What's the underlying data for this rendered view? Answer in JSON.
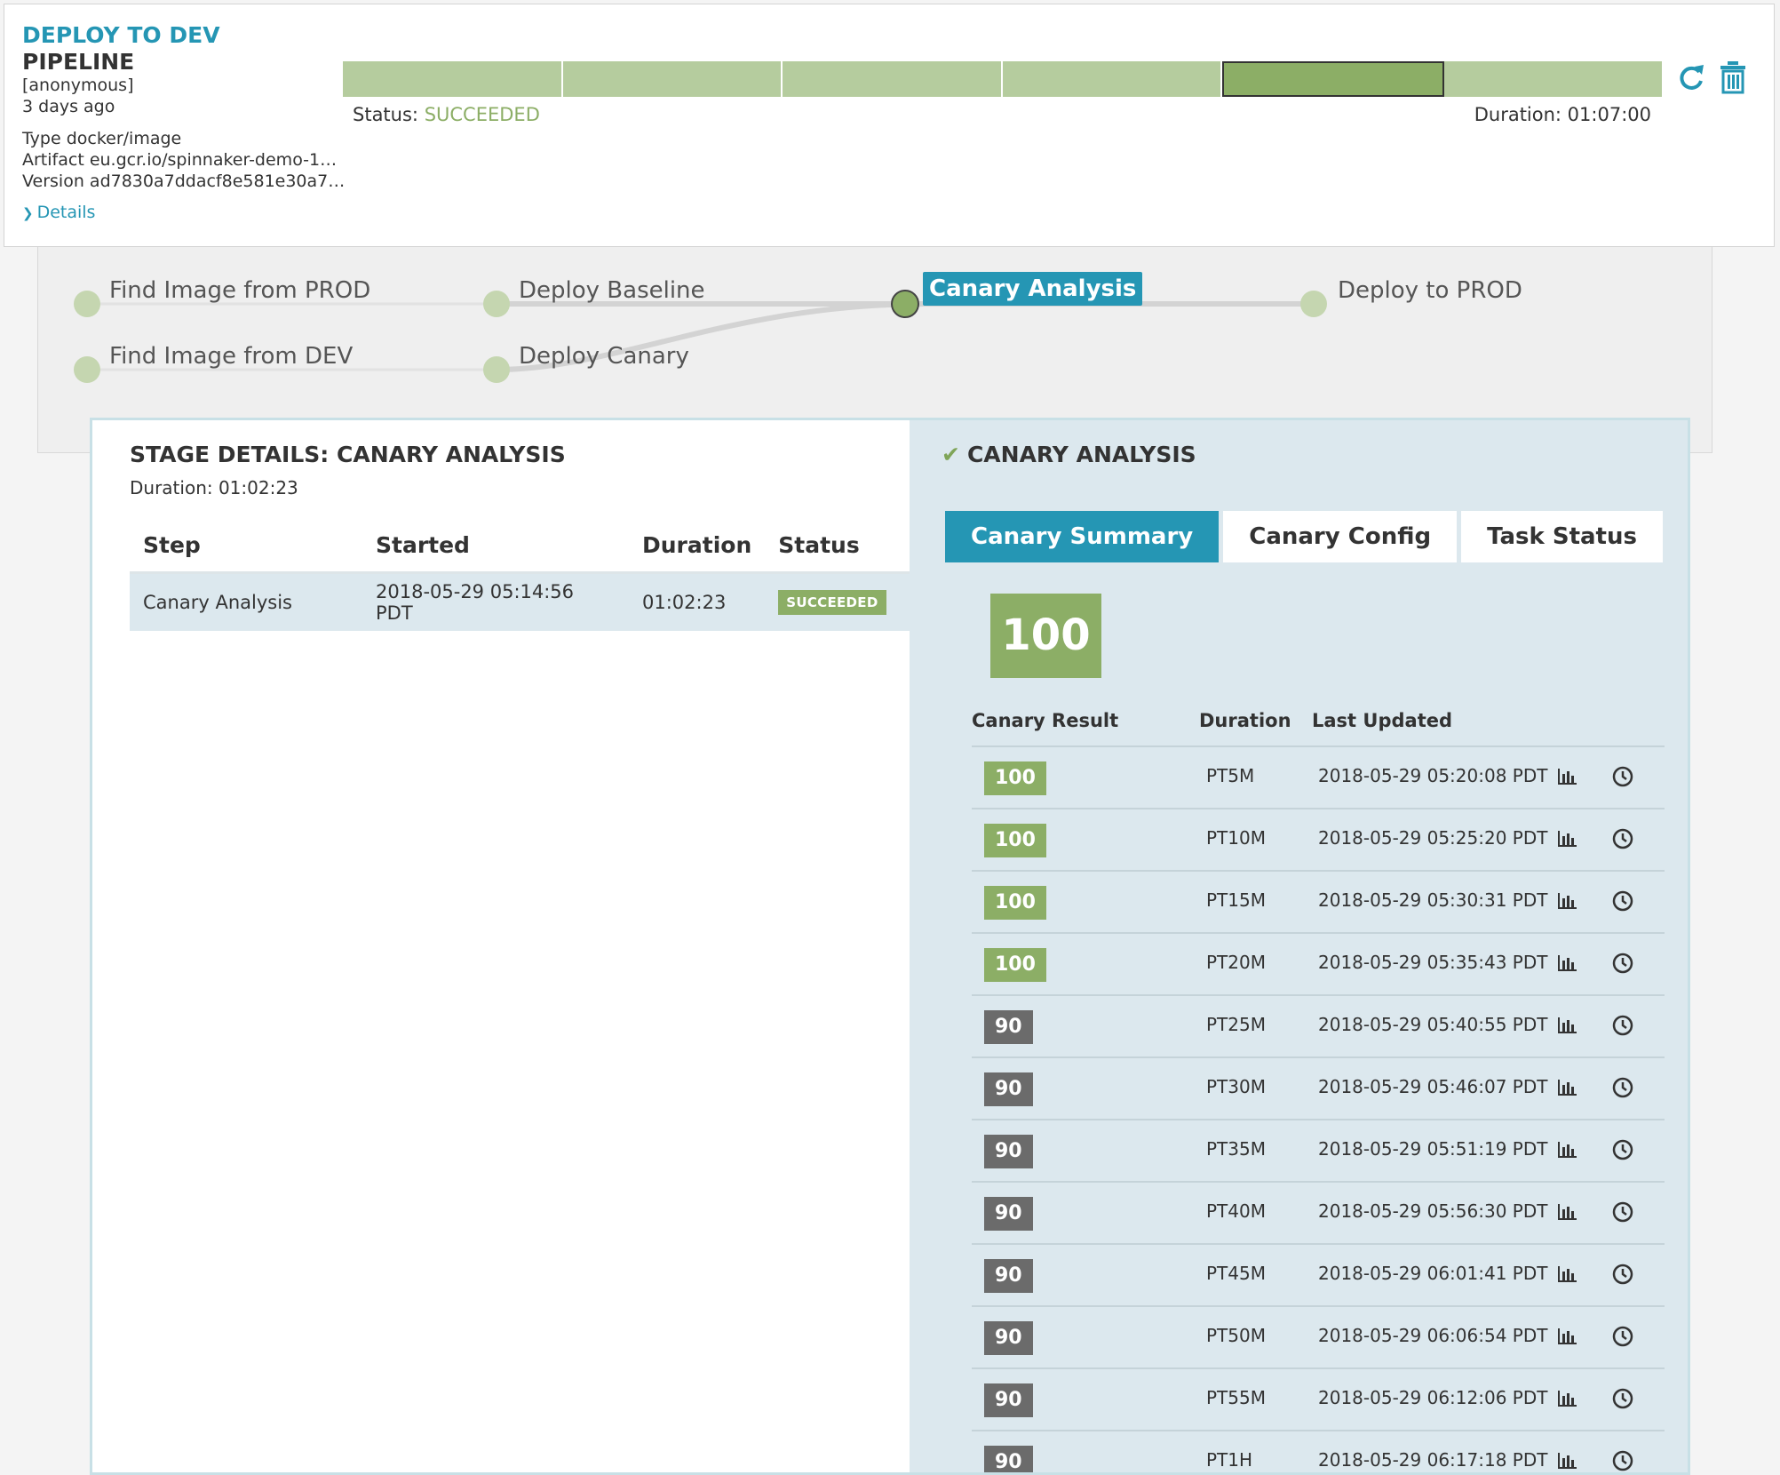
{
  "header": {
    "title": "DEPLOY TO DEV",
    "subtitle": "PIPELINE",
    "trigger_user": "[anonymous]",
    "time_ago": "3 days ago",
    "type_label": "Type",
    "type_value": "docker/image",
    "artifact_label": "Artifact",
    "artifact_value": "eu.gcr.io/spinnaker-demo-1…",
    "version_label": "Version",
    "version_value": "ad7830a7ddacf8e581e30a7…",
    "details_link": "Details",
    "status_label": "Status:",
    "status_value": "SUCCEEDED",
    "duration_text": "Duration: 01:07:00",
    "progress_stages": 6,
    "progress_active_index": 4,
    "refresh_icon": "refresh-icon",
    "delete_icon": "trash-icon"
  },
  "graph": {
    "nodes": [
      {
        "label": "Find Image from PROD"
      },
      {
        "label": "Find Image from DEV"
      },
      {
        "label": "Deploy Baseline"
      },
      {
        "label": "Deploy Canary"
      },
      {
        "label": "Canary Analysis"
      },
      {
        "label": "Deploy to PROD"
      }
    ]
  },
  "stage_details": {
    "title": "STAGE DETAILS: CANARY ANALYSIS",
    "duration": "Duration: 01:02:23",
    "columns": [
      "Step",
      "Started",
      "Duration",
      "Status"
    ],
    "row": {
      "step": "Canary Analysis",
      "started": "2018-05-29 05:14:56 PDT",
      "duration": "01:02:23",
      "status": "SUCCEEDED"
    }
  },
  "canary": {
    "title": "CANARY ANALYSIS",
    "tabs": [
      "Canary Summary",
      "Canary Config",
      "Task Status"
    ],
    "score": "100",
    "headers": [
      "Canary Result",
      "Duration",
      "Last Updated"
    ],
    "results": [
      {
        "score": "100",
        "duration": "PT5M",
        "updated": "2018-05-29 05:20:08 PDT"
      },
      {
        "score": "100",
        "duration": "PT10M",
        "updated": "2018-05-29 05:25:20 PDT"
      },
      {
        "score": "100",
        "duration": "PT15M",
        "updated": "2018-05-29 05:30:31 PDT"
      },
      {
        "score": "100",
        "duration": "PT20M",
        "updated": "2018-05-29 05:35:43 PDT"
      },
      {
        "score": "90",
        "duration": "PT25M",
        "updated": "2018-05-29 05:40:55 PDT"
      },
      {
        "score": "90",
        "duration": "PT30M",
        "updated": "2018-05-29 05:46:07 PDT"
      },
      {
        "score": "90",
        "duration": "PT35M",
        "updated": "2018-05-29 05:51:19 PDT"
      },
      {
        "score": "90",
        "duration": "PT40M",
        "updated": "2018-05-29 05:56:30 PDT"
      },
      {
        "score": "90",
        "duration": "PT45M",
        "updated": "2018-05-29 06:01:41 PDT"
      },
      {
        "score": "90",
        "duration": "PT50M",
        "updated": "2018-05-29 06:06:54 PDT"
      },
      {
        "score": "90",
        "duration": "PT55M",
        "updated": "2018-05-29 06:12:06 PDT"
      },
      {
        "score": "90",
        "duration": "PT1H",
        "updated": "2018-05-29 06:17:18 PDT"
      }
    ]
  },
  "colors": {
    "accent": "#2596b4",
    "success": "#8cae66",
    "success_light": "#b5cc9e",
    "score_warn": "#6b6b6b",
    "panel_bg": "#dce8ee"
  }
}
